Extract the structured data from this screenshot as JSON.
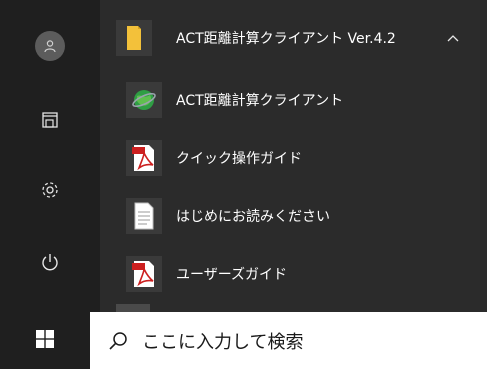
{
  "group": {
    "label": "ACT距離計算クライアント Ver.4.2"
  },
  "items": [
    {
      "label": "ACT距離計算クライアント",
      "icon": "globe-app-icon"
    },
    {
      "label": "クイック操作ガイド",
      "icon": "pdf-file-icon"
    },
    {
      "label": "はじめにお読みください",
      "icon": "text-document-icon"
    },
    {
      "label": "ユーザーズガイド",
      "icon": "pdf-file-icon"
    }
  ],
  "taskbar": {
    "search_placeholder": "ここに入力して検索"
  },
  "colors": {
    "rail": "#1f1f1f",
    "menu": "#2b2b2b",
    "folder": "#f3c13a",
    "pdf": "#cc1f1f"
  }
}
